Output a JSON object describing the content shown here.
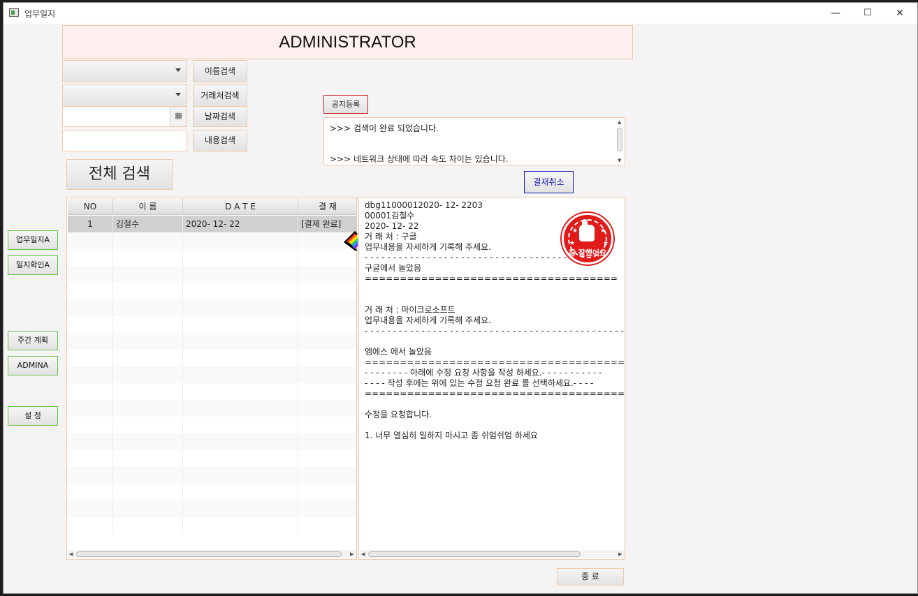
{
  "window": {
    "title": "업무일지",
    "minimize_icon": "minimize-icon",
    "maximize_icon": "maximize-icon",
    "close_icon": "close-icon",
    "min_glyph": "—",
    "max_glyph": "☐",
    "close_glyph": "✕"
  },
  "header": {
    "title": "ADMINISTRATOR"
  },
  "search": {
    "name_combo_value": "",
    "client_combo_value": "",
    "date_value": "",
    "content_value": "",
    "name_search_label": "이름검색",
    "client_search_label": "거래처검색",
    "date_search_label": "날짜검색",
    "content_search_label": "내용검색",
    "all_search_label": "전체 검색",
    "calendar_glyph": "▦"
  },
  "notice": {
    "register_label": "공지등록",
    "log_lines": [
      ">>> 검색이 완료 되었습니다.",
      ">>> 네트워크 상태에 따라 속도 차이는 있습니다."
    ],
    "cancel_approval_label": "결재취소"
  },
  "table": {
    "columns": [
      "NO",
      "이    름",
      "D  A  T  E",
      "결  재"
    ],
    "rows": [
      {
        "no": "1",
        "name": "김철수",
        "date": "2020- 12- 22",
        "status": "[결제 완료]"
      }
    ]
  },
  "detail": {
    "lines": [
      "dbg11000012020- 12- 2203",
      "00001김철수",
      "2020- 12- 22",
      "거 래 처 : 구글",
      "업무내용을 자세하게 기록해 주세요.",
      "- - - - - - - - - - - - - - - - - - - - - - - - - - - - - - - - - - - - - -",
      "구글에서 놀았음",
      "====================================",
      "",
      "",
      "거 래 처 : 마이크로소프트",
      "업무내용을 자세하게 기록해 주세요.",
      "- - - - - - - - - - - - - - - - - - - - - - - - - - - - - - - - - - - - - - - - - - - - - - - - - - -",
      "",
      "엠에스 에서 놀았음",
      "=========================================",
      "- - - - - - - - 아래에 수정 요청 사항을 작성 하세요.- - - - - - - - - - -",
      "- - - - 작성 후에는 위에 있는 수정 요청 완료 를 선택하세요.- - - -",
      "=========================================",
      "",
      "수정을 요청합니다.",
      "",
      "1. 너무 열심히 일하지 마시고 좀 쉬엄쉬엄 하세요"
    ],
    "stamp_text": "참 잘했어요"
  },
  "sidebar": {
    "items": [
      {
        "label": "업무일지A"
      },
      {
        "label": "일지확인A"
      },
      {
        "label": "주간 계획"
      },
      {
        "label": "ADMINA"
      },
      {
        "label": "설   정"
      }
    ]
  },
  "footer": {
    "close_label": "종   료"
  },
  "colors": {
    "accent_border": "#f0c8a8",
    "header_bg": "#fcefee",
    "stamp_red": "#e11a1a",
    "side_border": "#6cc24a",
    "cancel_border": "#1a1aaa",
    "register_border": "#cc2222"
  }
}
